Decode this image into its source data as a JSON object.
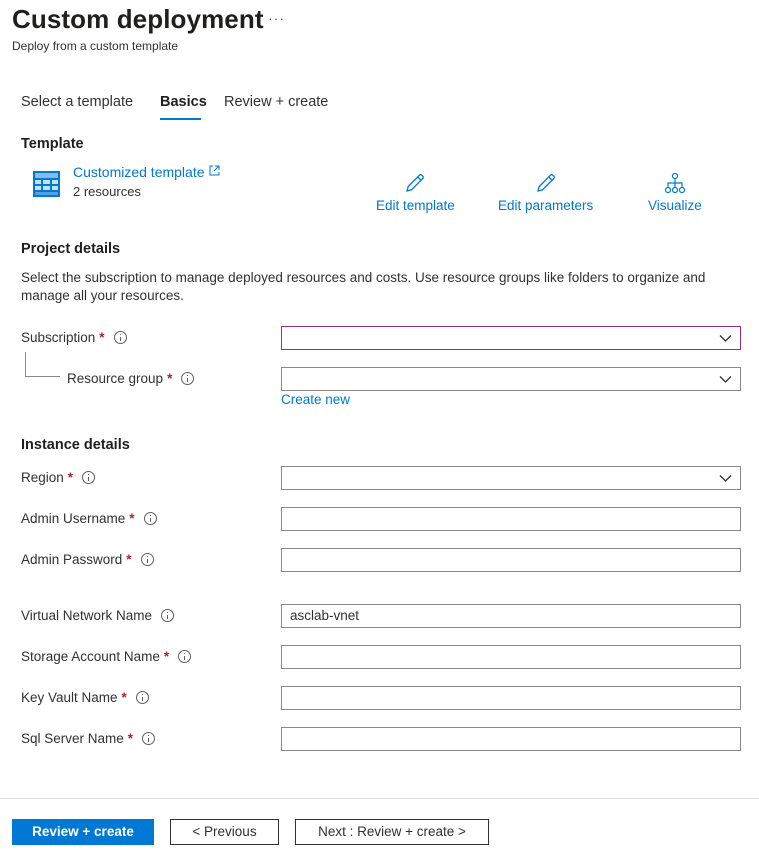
{
  "header": {
    "title": "Custom deployment",
    "more": "···",
    "subtitle": "Deploy from a custom template"
  },
  "tabs": [
    {
      "label": "Select a template",
      "active": false
    },
    {
      "label": "Basics",
      "active": true
    },
    {
      "label": "Review + create",
      "active": false
    }
  ],
  "template": {
    "section_title": "Template",
    "link": "Customized template",
    "resources": "2 resources",
    "actions": {
      "edit_template": "Edit template",
      "edit_parameters": "Edit parameters",
      "visualize": "Visualize"
    }
  },
  "project": {
    "section_title": "Project details",
    "description": "Select the subscription to manage deployed resources and costs. Use resource groups like folders to organize and manage all your resources.",
    "subscription": {
      "label": "Subscription",
      "value": ""
    },
    "resource_group": {
      "label": "Resource group",
      "value": ""
    },
    "create_new": "Create new"
  },
  "instance": {
    "section_title": "Instance details",
    "region": {
      "label": "Region",
      "value": ""
    },
    "admin_username": {
      "label": "Admin Username",
      "value": ""
    },
    "admin_password": {
      "label": "Admin Password",
      "value": ""
    },
    "vnet_name": {
      "label": "Virtual Network Name",
      "value": "asclab-vnet"
    },
    "storage_account": {
      "label": "Storage Account Name",
      "value": ""
    },
    "key_vault": {
      "label": "Key Vault Name",
      "value": ""
    },
    "sql_server": {
      "label": "Sql Server Name",
      "value": ""
    }
  },
  "required_marker": "*",
  "footer": {
    "review_create": "Review + create",
    "previous": "< Previous",
    "next": "Next : Review + create >"
  },
  "colors": {
    "accent": "#0078d4",
    "required": "#a4262c",
    "focus_border": "#8a2da5"
  }
}
